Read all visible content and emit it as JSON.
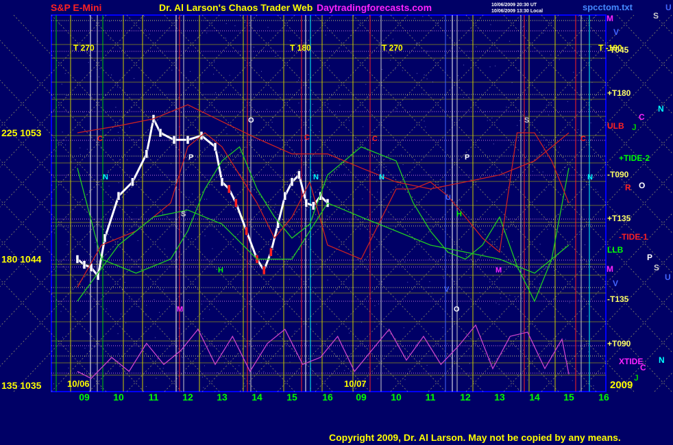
{
  "header": {
    "symbol": "S&P E-Mini",
    "title": "Dr. Al Larson's Chaos Trader Web",
    "site": "Daytradingforecasts.com",
    "timestamp_ut": "10/06/2009 20:30 UT",
    "timestamp_local": "10/06/2009 13:30 Local",
    "file": "spcctom.txt"
  },
  "footer": {
    "copyright": "Copyright 2009, Dr. Al Larson. May not be copied by any means."
  },
  "colors": {
    "background": "#000066",
    "plot_border": "#0000ff",
    "title_red": "#ff2222",
    "title_yellow": "#ffff00",
    "site_magenta": "#ff22ff",
    "copyright": "#ffff00"
  },
  "chart_data": {
    "type": "line",
    "ylabel": "",
    "xlabel": "",
    "ylim": [
      1035,
      1055
    ],
    "y_ticks": [
      {
        "label": "225  1053",
        "value": 1053
      },
      {
        "label": "180  1044",
        "value": 1044
      },
      {
        "label": "135  1035",
        "value": 1035
      }
    ],
    "x_ticks": [
      "09",
      "10",
      "11",
      "12",
      "13",
      "14",
      "15",
      "16",
      "09",
      "10",
      "11",
      "12",
      "13",
      "14",
      "15",
      "16"
    ],
    "date_labels": [
      "10/06",
      "10/07"
    ],
    "year_label": "2009",
    "top_labels": [
      "T  270",
      "T  180",
      "T  270",
      "T -180"
    ],
    "right_labels": [
      {
        "text": "M",
        "color": "#ff22ff"
      },
      {
        "text": "S",
        "color": "#cccccc"
      },
      {
        "text": "U",
        "color": "#4466ff"
      },
      {
        "text": "V",
        "color": "#4466ff"
      },
      {
        "text": "-T045",
        "color": "#ffff66"
      },
      {
        "text": "+T180",
        "color": "#ffff66"
      },
      {
        "text": "ULB",
        "color": "#ff2222"
      },
      {
        "text": "C",
        "color": "#ff22ff"
      },
      {
        "text": "N",
        "color": "#00ffff"
      },
      {
        "text": "J",
        "color": "#00cc00"
      },
      {
        "text": "+TIDE-2",
        "color": "#00ff00"
      },
      {
        "text": "-T090",
        "color": "#ffff66"
      },
      {
        "text": "R",
        "color": "#ff2222"
      },
      {
        "text": "O",
        "color": "#ffffff"
      },
      {
        "text": "+T135",
        "color": "#ffff66"
      },
      {
        "text": "-TIDE-1",
        "color": "#ff2222"
      },
      {
        "text": "LLB",
        "color": "#00ff00"
      },
      {
        "text": "P",
        "color": "#ffffff"
      },
      {
        "text": "S",
        "color": "#cccccc"
      },
      {
        "text": "U",
        "color": "#4466ff"
      },
      {
        "text": "M",
        "color": "#ff22ff"
      },
      {
        "text": "V",
        "color": "#4466ff"
      },
      {
        "text": "-T135",
        "color": "#ffff66"
      },
      {
        "text": "+T090",
        "color": "#ffff66"
      },
      {
        "text": "XTIDE",
        "color": "#ff22ff"
      },
      {
        "text": "N",
        "color": "#00ffff"
      },
      {
        "text": "C",
        "color": "#ff22ff"
      },
      {
        "text": "J",
        "color": "#00cc00"
      }
    ],
    "planet_markers": [
      {
        "text": "C",
        "color": "#ff2222"
      },
      {
        "text": "N",
        "color": "#00ffff"
      },
      {
        "text": "P",
        "color": "#ffffff"
      },
      {
        "text": "O",
        "color": "#ffffff"
      },
      {
        "text": "S",
        "color": "#cccccc"
      },
      {
        "text": "H",
        "color": "#00ff00"
      },
      {
        "text": "M",
        "color": "#ff22ff"
      },
      {
        "text": "C",
        "color": "#ff2222"
      },
      {
        "text": "N",
        "color": "#00ffff"
      },
      {
        "text": "C",
        "color": "#ff2222"
      },
      {
        "text": "N",
        "color": "#00ffff"
      },
      {
        "text": "P",
        "color": "#ffffff"
      },
      {
        "text": "S",
        "color": "#cccccc"
      },
      {
        "text": "H",
        "color": "#00ff00"
      },
      {
        "text": "M",
        "color": "#ff22ff"
      },
      {
        "text": "O",
        "color": "#ffffff"
      },
      {
        "text": "C",
        "color": "#ff2222"
      },
      {
        "text": "N",
        "color": "#00ffff"
      },
      {
        "text": "V",
        "color": "#4466ff"
      },
      {
        "text": "U",
        "color": "#4466ff"
      }
    ],
    "series": [
      {
        "name": "price",
        "x": [
          8.8,
          9,
          9.2,
          9.4,
          9.6,
          10,
          10.4,
          10.8,
          11,
          11.2,
          11.6,
          12,
          12.4,
          12.8,
          13,
          13.2,
          13.4,
          13.7,
          14,
          14.2,
          14.4,
          14.6,
          14.8,
          15,
          15.2,
          15.4,
          15.6,
          15.8,
          16
        ],
        "values": [
          1044,
          1043.6,
          1043.4,
          1042.8,
          1045.5,
          1048.5,
          1049.5,
          1051.5,
          1054,
          1053,
          1052.5,
          1052.5,
          1052.8,
          1052,
          1049.5,
          1049,
          1048,
          1046,
          1044,
          1043.2,
          1044.5,
          1046.5,
          1048.5,
          1049.5,
          1050,
          1048,
          1047.8,
          1048.5,
          1048
        ]
      },
      {
        "name": "+TIDE-2",
        "x": [
          8.8,
          9.5,
          10.5,
          11.5,
          12,
          12.5,
          13,
          13.5,
          14,
          14.5,
          15,
          15.5,
          16,
          17,
          18,
          18.5,
          19,
          19.5,
          20,
          20.5,
          21,
          21.5,
          22,
          22.5,
          23
        ],
        "values": [
          1050.5,
          1044,
          1043,
          1044,
          1046,
          1049,
          1051,
          1052,
          1049,
          1047,
          1045.5,
          1046.5,
          1050,
          1052,
          1051,
          1048,
          1046,
          1044.5,
          1044,
          1045,
          1047,
          1043.5,
          1041,
          1044,
          1050.5
        ]
      },
      {
        "name": "-TIDE-1",
        "x": [
          8.8,
          9.5,
          10.5,
          11.5,
          12,
          12.5,
          13,
          13.5,
          14,
          14.5,
          15,
          15.5,
          16,
          17,
          18,
          18.5,
          19,
          19.5,
          20,
          20.5,
          21,
          21.5,
          22,
          22.5,
          23
        ],
        "values": [
          1042,
          1045,
          1046,
          1048,
          1052,
          1053,
          1052,
          1050,
          1048,
          1045.5,
          1047,
          1049.5,
          1045,
          1044,
          1049,
          1049,
          1049.5,
          1048.5,
          1047,
          1045.5,
          1044.5,
          1053,
          1053,
          1051,
          1048
        ]
      },
      {
        "name": "ULB",
        "x": [
          8.8,
          10,
          11,
          12,
          13,
          14,
          15,
          16,
          17,
          18,
          19,
          20,
          21,
          22,
          23
        ],
        "values": [
          1053,
          1053.5,
          1054,
          1055,
          1053.8,
          1052.6,
          1051.5,
          1051.5,
          1050.5,
          1049.5,
          1049,
          1049.5,
          1050,
          1051,
          1053
        ]
      },
      {
        "name": "LLB",
        "x": [
          8.8,
          10,
          11,
          12,
          13,
          14,
          15,
          16,
          17,
          18,
          19,
          20,
          21,
          22,
          23
        ],
        "values": [
          1041,
          1045,
          1047,
          1047.5,
          1046.5,
          1044,
          1044,
          1048,
          1047,
          1046,
          1045,
          1044.5,
          1044,
          1043,
          1045
        ]
      },
      {
        "name": "XTIDE",
        "x": [
          8.8,
          9.2,
          9.8,
          10.3,
          10.8,
          11.3,
          11.8,
          12.3,
          12.8,
          13.3,
          13.8,
          14.3,
          14.8,
          15.3,
          15.8,
          16.3,
          16.8,
          17.3,
          17.8,
          18.3,
          18.8,
          19.3,
          19.8,
          20.3,
          20.8,
          21.3,
          21.8,
          22.3,
          22.8,
          23
        ],
        "values": [
          1036,
          1035.5,
          1037,
          1036,
          1038,
          1036.5,
          1037.5,
          1039,
          1036.5,
          1038.5,
          1036,
          1038,
          1039,
          1036.5,
          1037,
          1038.5,
          1036,
          1037.5,
          1039,
          1036.8,
          1038.5,
          1036.5,
          1037.8,
          1039.3,
          1036.2,
          1038.5,
          1038.8,
          1036.2,
          1038.3,
          1035.8
        ]
      }
    ]
  }
}
